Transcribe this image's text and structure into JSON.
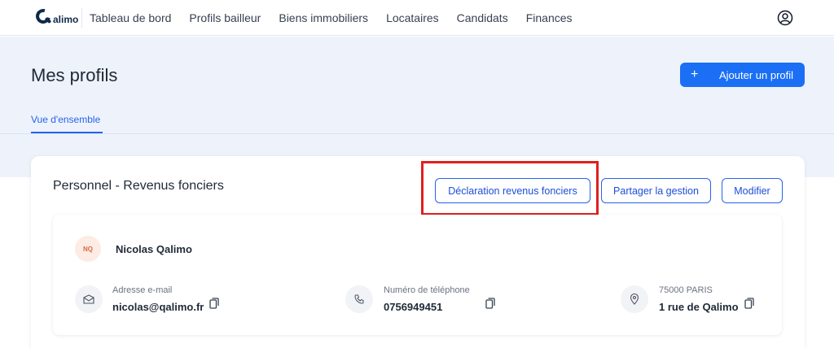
{
  "app": {
    "logo_text": "alimo"
  },
  "nav": {
    "items": [
      {
        "label": "Tableau de bord"
      },
      {
        "label": "Profils bailleur"
      },
      {
        "label": "Biens immobiliers"
      },
      {
        "label": "Locataires"
      },
      {
        "label": "Candidats"
      },
      {
        "label": "Finances"
      }
    ],
    "user_icon": "user-circle-icon"
  },
  "header": {
    "title": "Mes profils",
    "add_button": {
      "icon": "plus-icon",
      "label": "Ajouter un profil"
    },
    "tabs": [
      {
        "label": "Vue d'ensemble",
        "active": true
      }
    ]
  },
  "profile": {
    "title": "Personnel - Revenus fonciers",
    "actions": {
      "declaration": "Déclaration revenus fonciers",
      "share": "Partager la gestion",
      "edit": "Modifier"
    },
    "person": {
      "initials": "NQ",
      "name": "Nicolas Qalimo"
    },
    "fields": [
      {
        "icon": "mail-icon",
        "label": "Adresse e-mail",
        "value": "nicolas@qalimo.fr"
      },
      {
        "icon": "phone-icon",
        "label": "Numéro de téléphone",
        "value": "0756949451"
      },
      {
        "icon": "location-pin-icon",
        "label": "75000 PARIS",
        "value": "1 rue de Qalimo"
      }
    ]
  },
  "colors": {
    "accent": "#1a6ff5",
    "highlight": "#e02020",
    "hero_bg": "#eef3fb",
    "avatar_bg": "#fdece4"
  }
}
